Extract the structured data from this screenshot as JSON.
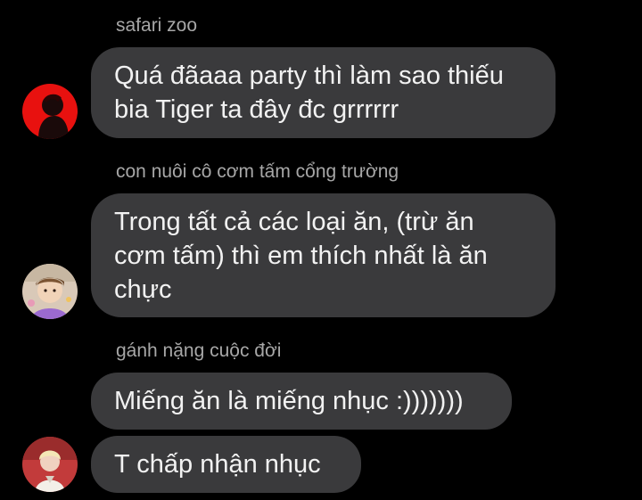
{
  "colors": {
    "background": "#000000",
    "bubble": "#3a3a3c",
    "sender_text": "#a7a7a7",
    "message_text": "#f2f2f2"
  },
  "messages": [
    {
      "sender": "safari zoo",
      "avatar_icon": "red-silhouette-avatar",
      "bubbles": [
        "Quá đãaaa party thì làm sao thiếu\nbia Tiger ta đây đc grrrrrr"
      ]
    },
    {
      "sender": "con nuôi cô cơm tấm cổng trường",
      "avatar_icon": "cartoon-portrait-avatar",
      "bubbles": [
        "Trong tất cả các loại ăn, (trừ ăn\ncơm tấm) thì em thích nhất là ăn\nchực"
      ]
    },
    {
      "sender": "gánh nặng cuộc đời",
      "avatar_icon": "blond-portrait-avatar",
      "bubbles": [
        "Miếng ăn là miếng nhục :)))))))",
        "T chấp nhận nhục"
      ]
    }
  ]
}
